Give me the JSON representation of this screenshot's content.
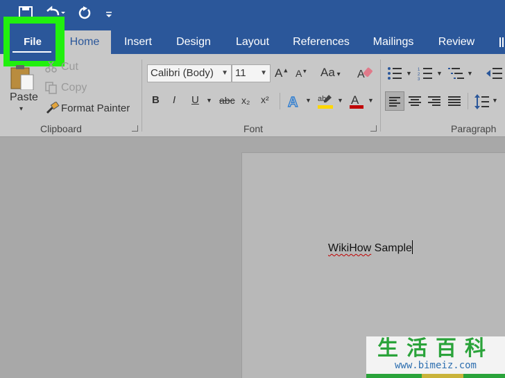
{
  "quick_access": {
    "save_icon": "save-icon",
    "undo_icon": "undo-icon",
    "redo_icon": "redo-icon",
    "customize_icon": "customize-qat-icon"
  },
  "tabs": [
    {
      "label": "File"
    },
    {
      "label": "Home"
    },
    {
      "label": "Insert"
    },
    {
      "label": "Design"
    },
    {
      "label": "Layout"
    },
    {
      "label": "References"
    },
    {
      "label": "Mailings"
    },
    {
      "label": "Review"
    }
  ],
  "clipboard": {
    "paste": "Paste",
    "cut": "Cut",
    "copy": "Copy",
    "format_painter": "Format Painter",
    "label": "Clipboard"
  },
  "font": {
    "name": "Calibri (Body)",
    "size": "11",
    "change_case": "Aa",
    "bold": "B",
    "italic": "I",
    "underline": "U",
    "strikethrough": "abc",
    "subscript": "x₂",
    "superscript": "x²",
    "label": "Font"
  },
  "paragraph": {
    "label": "Paragraph"
  },
  "document": {
    "text_word1": "WikiHow",
    "text_word2": " Sample"
  },
  "watermark": {
    "chars": "生活百科",
    "url": "www.bimeiz.com"
  },
  "colors": {
    "brand": "#2b579a",
    "highlight": "#21f00e",
    "ribbon": "#c8c8c8",
    "font_color": "#c00000",
    "highlighter": "#ffd700"
  }
}
